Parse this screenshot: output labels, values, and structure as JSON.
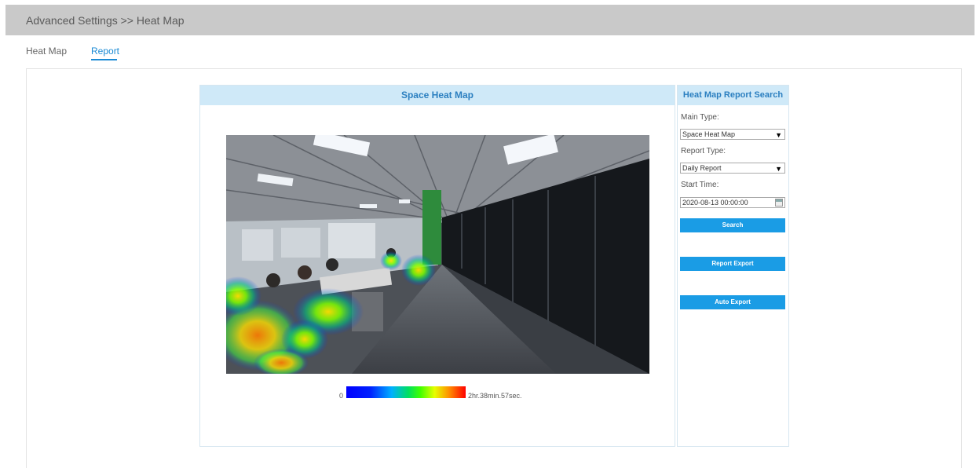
{
  "header": {
    "title": "Advanced Settings >> Heat Map"
  },
  "tabs": [
    {
      "label": "Heat Map",
      "active": false
    },
    {
      "label": "Report",
      "active": true
    }
  ],
  "left_panel": {
    "title": "Space Heat Map",
    "legend": {
      "min_label": "0",
      "max_label": "2hr.38min.57sec."
    }
  },
  "right_panel": {
    "title": "Heat Map Report Search",
    "main_type": {
      "label": "Main Type:",
      "value": "Space Heat Map"
    },
    "report_type": {
      "label": "Report Type:",
      "value": "Daily Report"
    },
    "start_time": {
      "label": "Start Time:",
      "value": "2020-08-13 00:00:00"
    },
    "buttons": {
      "search": "Search",
      "report_export": "Report Export",
      "auto_export": "Auto Export"
    }
  },
  "colors": {
    "accent": "#1a9ce5",
    "header_bg": "#c9c9c9",
    "panel_head_bg": "#cfe9f8"
  }
}
